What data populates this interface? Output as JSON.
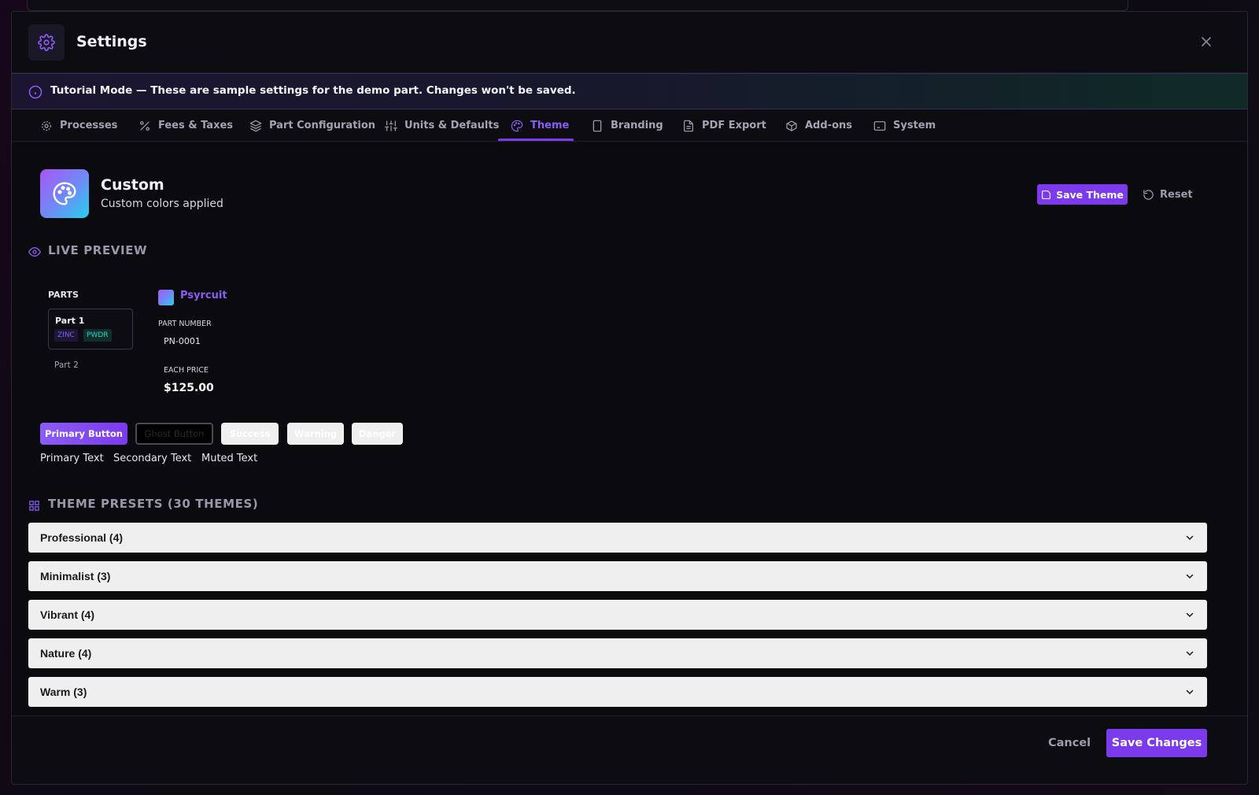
{
  "dialog": {
    "title": "Settings",
    "header_icon": "gear-icon",
    "close_icon": "close-icon"
  },
  "banner": {
    "icon": "info-icon",
    "text": "Tutorial Mode — These are sample settings for the demo part. Changes won't be saved."
  },
  "tabs": [
    {
      "label": "Processes",
      "icon": "gear-icon"
    },
    {
      "label": "Fees & Taxes",
      "icon": "percent-icon"
    },
    {
      "label": "Part Configuration",
      "icon": "layers-icon"
    },
    {
      "label": "Units & Defaults",
      "icon": "sliders-icon"
    },
    {
      "label": "Theme",
      "icon": "palette-icon",
      "active": true
    },
    {
      "label": "Branding",
      "icon": "tablet-icon"
    },
    {
      "label": "PDF Export",
      "icon": "file-icon"
    },
    {
      "label": "Add-ons",
      "icon": "package-icon"
    },
    {
      "label": "System",
      "icon": "monitor-icon"
    }
  ],
  "theme": {
    "name": "Custom",
    "subtitle": "Custom colors applied",
    "save_label": "Save Theme",
    "reset_label": "Reset"
  },
  "live_preview": {
    "title": "LIVE PREVIEW",
    "parts_label": "PARTS",
    "part1": "Part 1",
    "tag1": "ZINC",
    "tag2": "PWDR",
    "part2": "Part 2",
    "brand": "Psyrcuit",
    "part_number_label": "PART NUMBER",
    "part_number": "PN-0001",
    "each_price_label": "EACH PRICE",
    "each_price": "$125.00",
    "buttons": {
      "primary": "Primary Button",
      "ghost": "Ghost Button",
      "success": "Success",
      "warning": "Warning",
      "danger": "Danger"
    },
    "text_samples": {
      "primary": "Primary Text",
      "secondary": "Secondary Text",
      "muted": "Muted Text"
    }
  },
  "presets": {
    "title": "THEME PRESETS (30 THEMES)",
    "groups": [
      {
        "label": "Professional (4)"
      },
      {
        "label": "Minimalist (3)"
      },
      {
        "label": "Vibrant (4)"
      },
      {
        "label": "Nature (4)"
      },
      {
        "label": "Warm (3)"
      }
    ]
  },
  "footer": {
    "cancel_label": "Cancel",
    "save_label": "Save Changes"
  },
  "colors": {
    "accent": "#7c3aed",
    "accent_text": "#8b5cf6",
    "background": "#0b0a0f",
    "teal": "#2dd4bf"
  }
}
